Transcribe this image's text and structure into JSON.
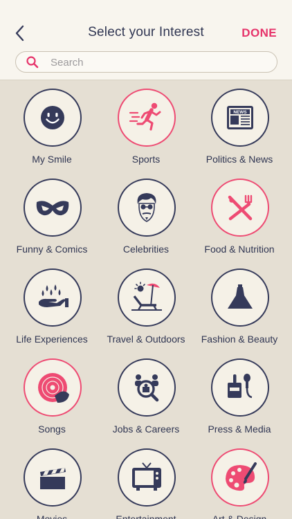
{
  "header": {
    "title": "Select your Interest",
    "done_label": "DONE"
  },
  "search": {
    "placeholder": "Search",
    "value": ""
  },
  "colors": {
    "accent": "#e6336a",
    "navy": "#353a5a",
    "pink": "#ee4b73",
    "background": "#e5dfd3"
  },
  "interests": [
    {
      "label": "My Smile",
      "icon": "smile-icon",
      "selected": false
    },
    {
      "label": "Sports",
      "icon": "runner-icon",
      "selected": true
    },
    {
      "label": "Politics & News",
      "icon": "newspaper-icon",
      "selected": false
    },
    {
      "label": "Funny & Comics",
      "icon": "mask-icon",
      "selected": false
    },
    {
      "label": "Celebrities",
      "icon": "celebrity-face-icon",
      "selected": false
    },
    {
      "label": "Food & Nutrition",
      "icon": "fork-knife-icon",
      "selected": true
    },
    {
      "label": "Life Experiences",
      "icon": "rain-hand-icon",
      "selected": false
    },
    {
      "label": "Travel & Outdoors",
      "icon": "beach-chair-icon",
      "selected": false
    },
    {
      "label": "Fashion & Beauty",
      "icon": "dress-icon",
      "selected": false
    },
    {
      "label": "Songs",
      "icon": "vinyl-record-icon",
      "selected": true
    },
    {
      "label": "Jobs & Careers",
      "icon": "job-search-icon",
      "selected": false
    },
    {
      "label": "Press & Media",
      "icon": "press-microphone-icon",
      "selected": false
    },
    {
      "label": "Movies",
      "icon": "clapperboard-icon",
      "selected": false
    },
    {
      "label": "Entertainment",
      "icon": "television-icon",
      "selected": false
    },
    {
      "label": "Art & Design",
      "icon": "palette-icon",
      "selected": true
    }
  ]
}
